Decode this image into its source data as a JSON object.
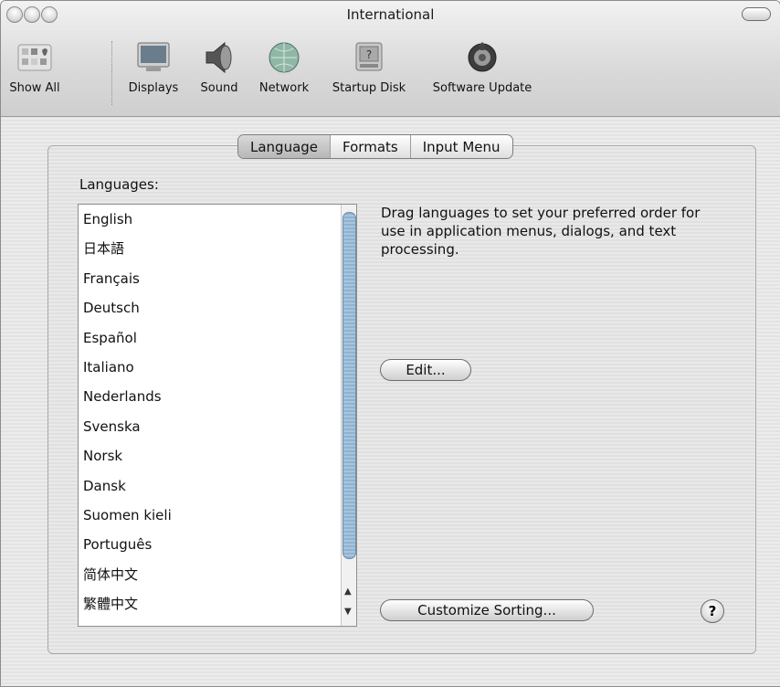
{
  "window": {
    "title": "International"
  },
  "toolbar": {
    "items": [
      {
        "label": "Show All",
        "icon": "apple-grid-icon"
      },
      {
        "label": "Displays",
        "icon": "monitor-icon"
      },
      {
        "label": "Sound",
        "icon": "speaker-icon"
      },
      {
        "label": "Network",
        "icon": "globe-icon"
      },
      {
        "label": "Startup Disk",
        "icon": "hard-disk-icon"
      },
      {
        "label": "Software Update",
        "icon": "software-update-icon"
      }
    ]
  },
  "tabs": [
    {
      "label": "Language",
      "selected": true
    },
    {
      "label": "Formats",
      "selected": false
    },
    {
      "label": "Input Menu",
      "selected": false
    }
  ],
  "languages": {
    "label": "Languages:",
    "items": [
      "English",
      "日本語",
      "Français",
      "Deutsch",
      "Español",
      "Italiano",
      "Nederlands",
      "Svenska",
      "Norsk",
      "Dansk",
      "Suomen kieli",
      "Português",
      "简体中文",
      "繁體中文"
    ]
  },
  "description": "Drag languages to set your preferred order for use in application menus, dialogs, and text processing.",
  "buttons": {
    "edit": "Edit...",
    "customize_sorting": "Customize Sorting...",
    "help": "?"
  }
}
